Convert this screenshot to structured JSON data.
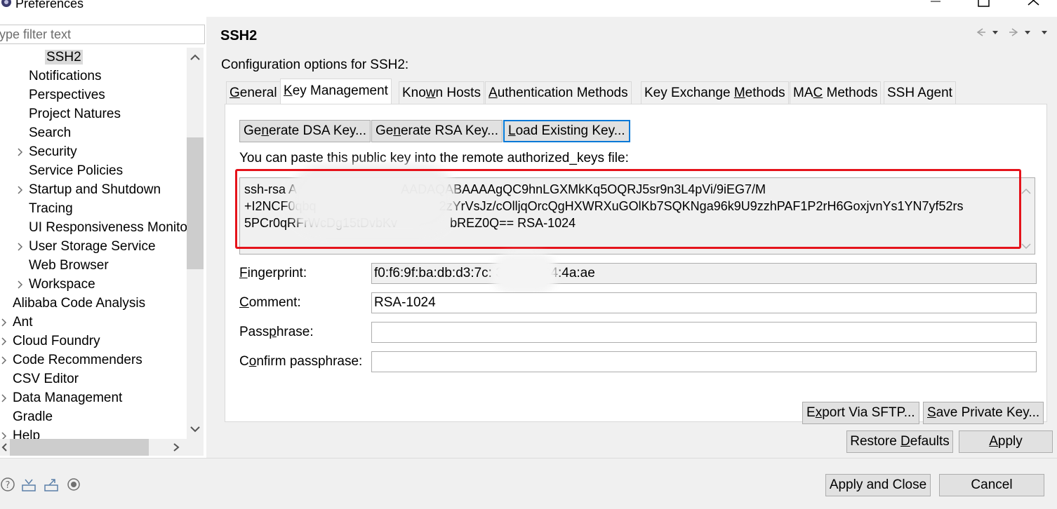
{
  "window": {
    "title": "Preferences"
  },
  "sidebar": {
    "filter_placeholder": "ype filter text",
    "items": [
      {
        "label": "SSH2",
        "indent": 2,
        "selected": true,
        "expandable": false
      },
      {
        "label": "Notifications",
        "indent": 1,
        "expandable": false
      },
      {
        "label": "Perspectives",
        "indent": 1,
        "expandable": false
      },
      {
        "label": "Project Natures",
        "indent": 1,
        "expandable": false
      },
      {
        "label": "Search",
        "indent": 1,
        "expandable": false
      },
      {
        "label": "Security",
        "indent": 1,
        "expandable": true
      },
      {
        "label": "Service Policies",
        "indent": 1,
        "expandable": false
      },
      {
        "label": "Startup and Shutdown",
        "indent": 1,
        "expandable": true
      },
      {
        "label": "Tracing",
        "indent": 1,
        "expandable": false
      },
      {
        "label": "UI Responsiveness Monito",
        "indent": 1,
        "expandable": false
      },
      {
        "label": "User Storage Service",
        "indent": 1,
        "expandable": true
      },
      {
        "label": "Web Browser",
        "indent": 1,
        "expandable": false
      },
      {
        "label": "Workspace",
        "indent": 1,
        "expandable": true
      },
      {
        "label": "Alibaba Code Analysis",
        "indent": 0,
        "expandable": false
      },
      {
        "label": "Ant",
        "indent": 0,
        "expandable": true
      },
      {
        "label": "Cloud Foundry",
        "indent": 0,
        "expandable": true
      },
      {
        "label": "Code Recommenders",
        "indent": 0,
        "expandable": true
      },
      {
        "label": "CSV Editor",
        "indent": 0,
        "expandable": false
      },
      {
        "label": "Data Management",
        "indent": 0,
        "expandable": true
      },
      {
        "label": "Gradle",
        "indent": 0,
        "expandable": false
      },
      {
        "label": "Help",
        "indent": 0,
        "expandable": true
      }
    ]
  },
  "page": {
    "title": "SSH2",
    "description": "Configuration options for SSH2:",
    "tabs": [
      {
        "label": "General",
        "active": false
      },
      {
        "label": "Key Management",
        "active": true
      },
      {
        "label": "Known Hosts",
        "active": false
      },
      {
        "label": "Authentication Methods",
        "active": false
      },
      {
        "label": "Key Exchange Methods",
        "active": false
      },
      {
        "label": "MAC Methods",
        "active": false
      },
      {
        "label": "SSH Agent",
        "active": false
      }
    ],
    "key_management": {
      "generate_dsa_label": "Generate DSA Key...",
      "generate_rsa_label": "Generate RSA Key...",
      "load_existing_label": "Load Existing Key...",
      "paste_label": "You can paste this public key into the remote authorized_keys file:",
      "public_key_lines": [
        "ssh-rsa A                              AADAQABAAAAgQC9hnLGXMkKq5OQRJ5sr9n3L4pVi/9iEG7/M",
        "+I2NCF0qbq                                   2zYrVsJz/cOlljqOrcQgHXWRXuGOlKb7SQKNga96k9U9zzhPAF1P2rH6GoxjvnYs1YN7yf52rs",
        "5PCr0qRFrWcDg15tDvbKv               bREZ0Q== RSA-1024"
      ],
      "fingerprint_label": "Fingerprint:",
      "fingerprint_value": "f0:f6:9f:ba:db:d3:7c:            3:c8:72:04:4a:ae",
      "comment_label": "Comment:",
      "comment_value": "RSA-1024",
      "passphrase_label": "Passphrase:",
      "passphrase_value": "",
      "confirm_passphrase_label": "Confirm passphrase:",
      "confirm_passphrase_value": "",
      "export_label": "Export Via SFTP...",
      "save_private_label": "Save Private Key..."
    },
    "restore_defaults_label": "Restore Defaults",
    "apply_label": "Apply"
  },
  "footer": {
    "apply_close_label": "Apply and Close",
    "cancel_label": "Cancel",
    "icons": [
      "help-icon",
      "import-icon",
      "export-icon",
      "record-icon"
    ]
  },
  "colors": {
    "highlight": "#e5131b",
    "focus": "#0078d7"
  }
}
